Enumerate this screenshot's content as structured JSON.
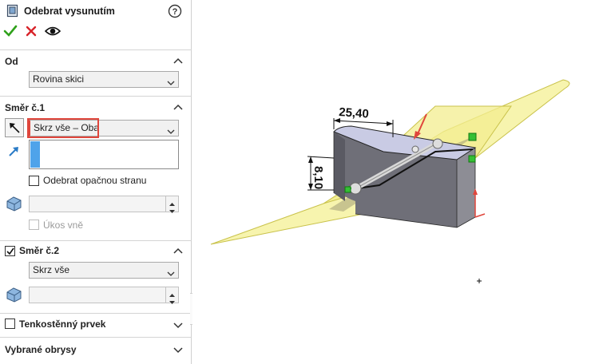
{
  "header": {
    "title": "Odebrat vysunutím"
  },
  "sections": {
    "from": {
      "title": "Od",
      "dropdown_value": "Rovina skici"
    },
    "direction1": {
      "title": "Směr č.1",
      "dropdown_value": "Skrz vše – Oba",
      "flip_side_label": "Odebrat opačnou stranu",
      "draft_label": "Úkos vně"
    },
    "direction2": {
      "title": "Směr č.2",
      "checked": true,
      "dropdown_value": "Skrz vše"
    },
    "thin_feature": {
      "title": "Tenkostěnný prvek",
      "checked": false
    },
    "selected_contours": {
      "title": "Vybrané obrysy"
    }
  },
  "viewport": {
    "dimension_horizontal": "25,40",
    "dimension_vertical": "8,10"
  },
  "colors": {
    "accent_red": "#e0463c",
    "selection_blue": "#4fa3ea",
    "surface_yellow": "#f6f2a0",
    "part_gray": "#8d8d95"
  }
}
